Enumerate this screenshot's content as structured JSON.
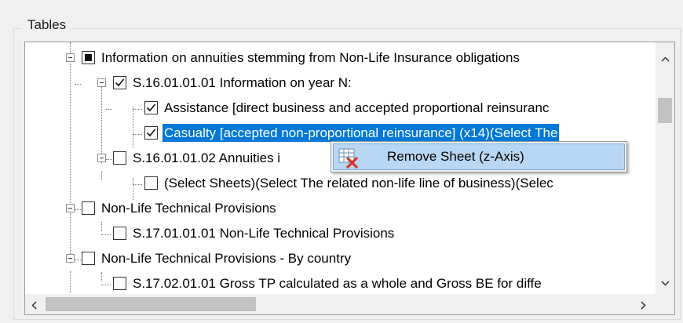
{
  "group": {
    "title": "Tables"
  },
  "tree": {
    "items": [
      {
        "label": "Information on annuities stemming from Non-Life Insurance obligations",
        "state": "indeterminate"
      },
      {
        "label": "S.16.01.01.01 Information on year N:",
        "state": "checked"
      },
      {
        "label": "Assistance [direct business and accepted proportional reinsuranc",
        "state": "checked"
      },
      {
        "label": "Casualty [accepted non-proportional reinsurance] (x14)(Select The",
        "state": "checked",
        "selected": true
      },
      {
        "label": "S.16.01.01.02 Annuities i",
        "state": "unchecked"
      },
      {
        "label": "(Select Sheets)(Select The related non-life line of business)(Selec",
        "state": "unchecked"
      },
      {
        "label": "Non-Life Technical Provisions",
        "state": "unchecked"
      },
      {
        "label": "S.17.01.01.01 Non-Life Technical Provisions",
        "state": "unchecked"
      },
      {
        "label": "Non-Life Technical Provisions - By country",
        "state": "unchecked"
      },
      {
        "label": "S.17.02.01.01 Gross TP calculated as a whole and Gross BE for diffe",
        "state": "unchecked"
      }
    ]
  },
  "scrollbars": {
    "up_arrow": "^",
    "down_arrow": "v",
    "left_arrow": "<",
    "right_arrow": ">"
  },
  "context_menu": {
    "items": [
      {
        "label": "Remove Sheet (z-Axis)",
        "icon": "remove-sheet-icon"
      }
    ]
  }
}
